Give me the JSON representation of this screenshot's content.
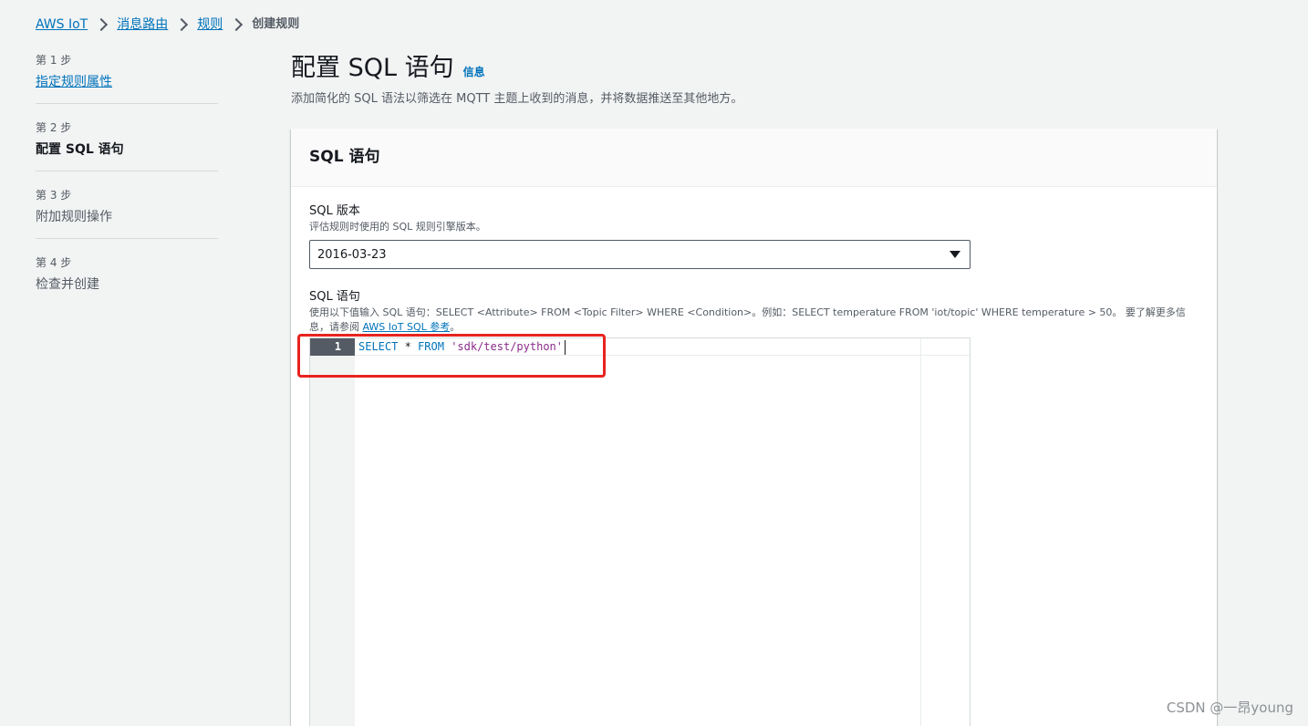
{
  "breadcrumb": {
    "items": [
      "AWS IoT",
      "消息路由",
      "规则"
    ],
    "current": "创建规则"
  },
  "steps": [
    {
      "num": "第 1 步",
      "label": "指定规则属性",
      "state": "link"
    },
    {
      "num": "第 2 步",
      "label": "配置 SQL 语句",
      "state": "current"
    },
    {
      "num": "第 3 步",
      "label": "附加规则操作",
      "state": "disabled"
    },
    {
      "num": "第 4 步",
      "label": "检查并创建",
      "state": "disabled"
    }
  ],
  "header": {
    "title": "配置 SQL 语句",
    "info": "信息",
    "description": "添加简化的 SQL 语法以筛选在 MQTT 主题上收到的消息，并将数据推送至其他地方。"
  },
  "container": {
    "title": "SQL 语句",
    "version_field": {
      "label": "SQL 版本",
      "description": "评估规则时使用的 SQL 规则引擎版本。",
      "value": "2016-03-23"
    },
    "sql_field": {
      "label": "SQL 语句",
      "description": "使用以下值输入 SQL 语句：SELECT <Attribute> FROM <Topic Filter> WHERE <Condition>。例如：SELECT temperature FROM 'iot/topic' WHERE temperature > 50。 要了解更多信息，请参阅 ",
      "link": "AWS IoT SQL 参考",
      "suffix": "。"
    },
    "editor": {
      "line_number": "1",
      "tokens": {
        "select": "SELECT",
        "star": " * ",
        "from": "FROM",
        "space": " ",
        "topic": "'sdk/test/python'"
      }
    }
  },
  "watermark": "CSDN @一昂young",
  "colors": {
    "link": "#0073bb",
    "highlight": "#e8231f"
  }
}
